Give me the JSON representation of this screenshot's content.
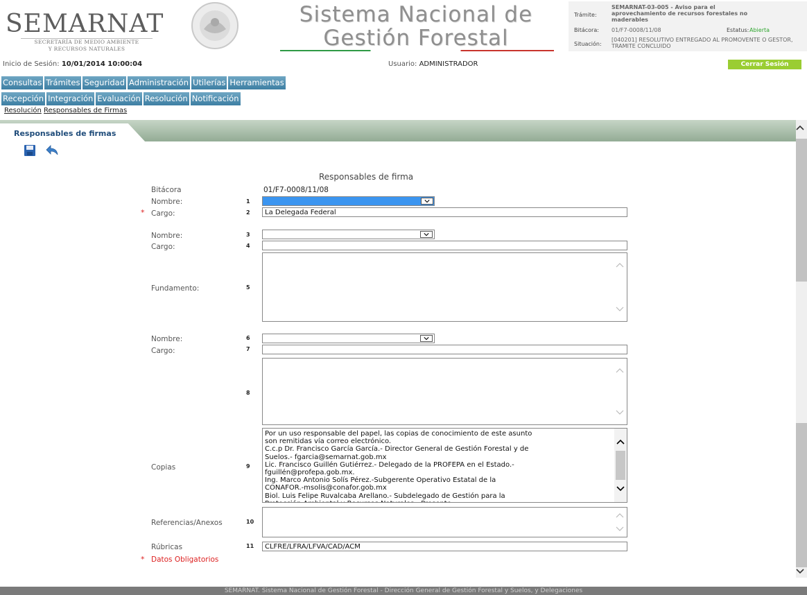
{
  "header": {
    "logo_text": "SEMARNAT",
    "logo_sub1": "SECRETARÍA DE MEDIO AMBIENTE",
    "logo_sub2": "Y RECURSOS NATURALES",
    "system_title_1": "Sistema Nacional de",
    "system_title_2": "Gestión Forestal",
    "info": {
      "tramite_label": "Trámite:",
      "tramite_value": "SEMARNAT-03-005 - Aviso para el aprovechamiento de recursos forestales no maderables",
      "bitacora_label": "Bitácora:",
      "bitacora_value": "01/F7-0008/11/08",
      "estatus_label": "Estatus:",
      "estatus_value": "Abierta",
      "situacion_label": "Situación:",
      "situacion_value": "[040201] RESOLUTIVO ENTREGADO AL PROMOVENTE O GESTOR, TRAMITE CONCLUIDO"
    },
    "session_label": "Inicio de Sesión:",
    "session_value": "10/01/2014 10:00:04",
    "user_label": "Usuario:",
    "user_value": "ADMINISTRADOR",
    "logout_label": "Cerrar Sesión"
  },
  "menu1": [
    "Consultas",
    "Trámites",
    "Seguridad",
    "Administración",
    "Utilerías",
    "Herramientas"
  ],
  "menu2": [
    "Recepción",
    "Integración",
    "Evaluación",
    "Resolución",
    "Notificación"
  ],
  "breadcrumb": [
    "Resolución",
    "Responsables de Firmas"
  ],
  "tab_label": "Responsables de firmas",
  "form": {
    "title": "Responsables de firma",
    "bitacora_label": "Bitácora",
    "bitacora_value": "01/F7-0008/11/08",
    "nombre_label": "Nombre:",
    "cargo_label": "Cargo:",
    "fundamento_label": "Fundamento:",
    "copias_label": "Copias",
    "referencias_label": "Referencias/Anexos",
    "rubricas_label": "Rúbricas",
    "required_mark": "*",
    "required_note": "Datos Obligatorios",
    "numbers": [
      "1",
      "2",
      "3",
      "4",
      "5",
      "6",
      "7",
      "8",
      "9",
      "10",
      "11"
    ],
    "cargo1_value": "La Delegada Federal",
    "cargo2_value": "",
    "cargo3_value": "",
    "rubricas_value": "CLFRE/LFRA/LFVA/CAD/ACM",
    "copias_value": "Por un uso responsable del papel, las copias de conocimiento de este asunto\nson remitidas vía correo electrónico.\nC.c.p Dr. Francisco García García.- Director General de Gestión Forestal y de\nSuelos.- fgarcia@semarnat.gob.mx\nLic. Francisco Guillén Gutiérrez.- Delegado de la PROFEPA en el Estado.-\nfguillén@profepa.gob.mx.\nIng. Marco Antonio Solís Pérez.-Subgerente Operativo Estatal de la\nCONAFOR.-msolis@conafor.gob.mx\nBiol. Luis Felipe Ruvalcaba Arellano.- Subdelegado de Gestión para la\nProtección Ambiental y Recursos Naturales.- Presente."
  },
  "footer": "SEMARNAT. Sistema Nacional de Gestión Forestal - Dirección General de Gestión Forestal y Suelos, y Delegaciones",
  "colors": {
    "menu": "#4a8cb0",
    "logout": "#9acd32",
    "estatus": "#2ea52e",
    "tab_label": "#1f4c7a",
    "required": "#dd2222"
  },
  "icons": [
    "save-icon",
    "undo-icon",
    "chevron-down-icon",
    "chevron-up-icon"
  ]
}
